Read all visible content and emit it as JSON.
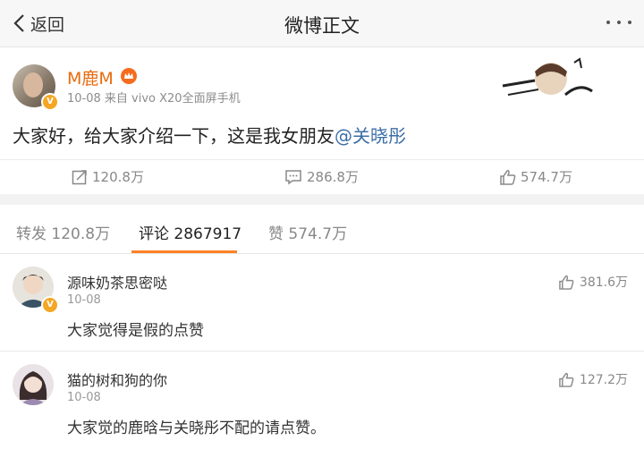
{
  "header": {
    "back_label": "返回",
    "title": "微博正文"
  },
  "post": {
    "author": "M鹿M",
    "meta": "10-08 来自 vivo X20全面屏手机",
    "content_text": "大家好，给大家介绍一下，这是我女朋友",
    "mention": "@关晓彤",
    "actions": {
      "repost_count": "120.8万",
      "comment_count": "286.8万",
      "like_count": "574.7万"
    }
  },
  "tabs": [
    {
      "label": "转发 120.8万",
      "active": false
    },
    {
      "label": "评论 2867917",
      "active": true
    },
    {
      "label": "赞 574.7万",
      "active": false
    }
  ],
  "comments": [
    {
      "name": "源味奶茶思密哒",
      "time": "10-08",
      "text": "大家觉得是假的点赞",
      "likes": "381.6万"
    },
    {
      "name": "猫的树和狗的你",
      "time": "10-08",
      "text": "大家觉的鹿晗与关晓彤不配的请点赞。",
      "likes": "127.2万"
    }
  ],
  "colors": {
    "accent": "#fd8225",
    "author": "#e86b0e",
    "mention": "#3d6ea7"
  }
}
